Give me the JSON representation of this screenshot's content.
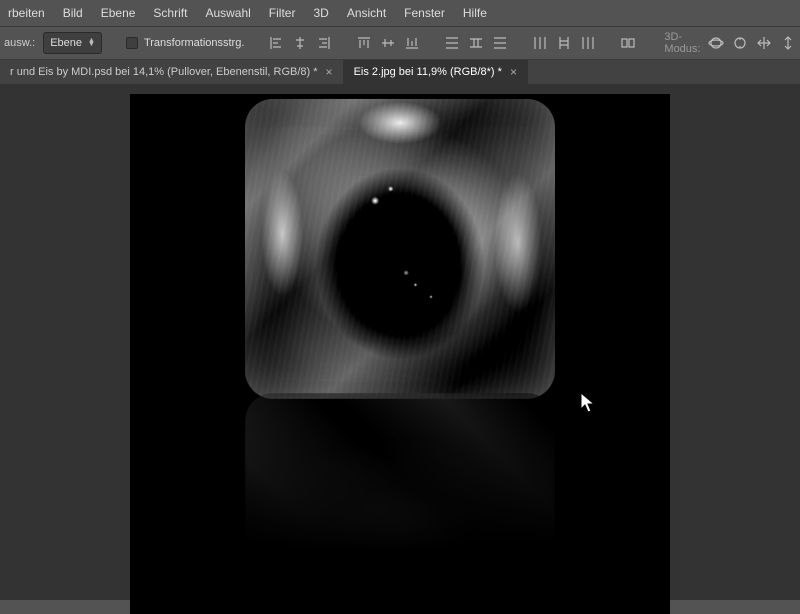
{
  "menu": {
    "items": [
      "rbeiten",
      "Bild",
      "Ebene",
      "Schrift",
      "Auswahl",
      "Filter",
      "3D",
      "Ansicht",
      "Fenster",
      "Hilfe"
    ]
  },
  "options": {
    "ausw_label": "ausw.:",
    "ausw_value": "Ebene",
    "transform_label": "Transformationsstrg.",
    "mode3d_label": "3D-Modus:"
  },
  "tabs": [
    {
      "label": "r und Eis by MDI.psd bei 14,1% (Pullover, Ebenenstil, RGB/8) *",
      "active": false
    },
    {
      "label": "Eis 2.jpg bei 11,9% (RGB/8*) *",
      "active": true
    }
  ]
}
